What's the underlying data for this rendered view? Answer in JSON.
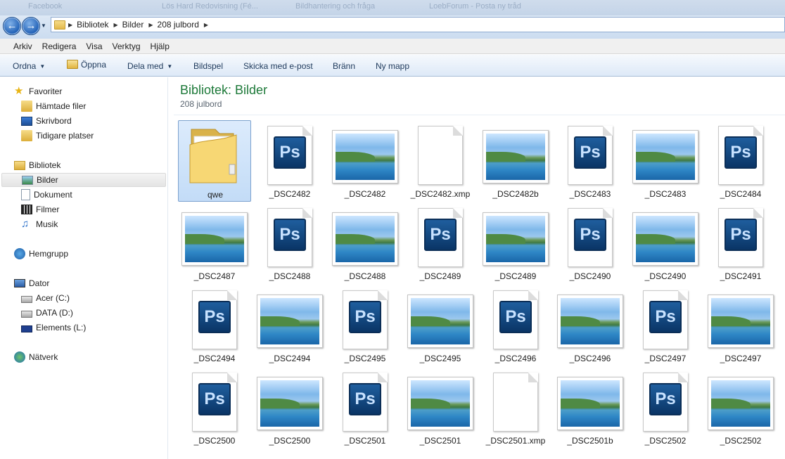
{
  "background_tabs": [
    "Facebook",
    "Lös Hard Redovisning (Fé...",
    "Bildhantering och fråga",
    "LoebForum - Posta ny tråd"
  ],
  "address": {
    "crumbs": [
      "Bibliotek",
      "Bilder",
      "208 julbord"
    ]
  },
  "menu": [
    "Arkiv",
    "Redigera",
    "Visa",
    "Verktyg",
    "Hjälp"
  ],
  "toolbar": {
    "organize": "Ordna",
    "open": "Öppna",
    "share": "Dela med",
    "slideshow": "Bildspel",
    "email": "Skicka med e-post",
    "burn": "Bränn",
    "new_folder": "Ny mapp"
  },
  "nav": {
    "favorites": "Favoriter",
    "downloads": "Hämtade filer",
    "desktop": "Skrivbord",
    "recent": "Tidigare platser",
    "libraries": "Bibliotek",
    "pictures": "Bilder",
    "documents": "Dokument",
    "videos": "Filmer",
    "music": "Musik",
    "homegroup": "Hemgrupp",
    "computer": "Dator",
    "drive_c": "Acer (C:)",
    "drive_d": "DATA (D:)",
    "drive_l": "Elements (L:)",
    "network": "Nätverk"
  },
  "content": {
    "title": "Bibliotek: Bilder",
    "subtitle": "208 julbord",
    "files": [
      {
        "name": "qwe",
        "kind": "folder"
      },
      {
        "name": "_DSC2482",
        "kind": "psd"
      },
      {
        "name": "_DSC2482",
        "kind": "photo"
      },
      {
        "name": "_DSC2482.xmp",
        "kind": "blank"
      },
      {
        "name": "_DSC2482b",
        "kind": "photo"
      },
      {
        "name": "_DSC2483",
        "kind": "psd"
      },
      {
        "name": "_DSC2483",
        "kind": "photo"
      },
      {
        "name": "_DSC2484",
        "kind": "psd"
      },
      {
        "name": "_DSC2487",
        "kind": "photo"
      },
      {
        "name": "_DSC2488",
        "kind": "psd"
      },
      {
        "name": "_DSC2488",
        "kind": "photo"
      },
      {
        "name": "_DSC2489",
        "kind": "psd"
      },
      {
        "name": "_DSC2489",
        "kind": "photo"
      },
      {
        "name": "_DSC2490",
        "kind": "psd"
      },
      {
        "name": "_DSC2490",
        "kind": "photo"
      },
      {
        "name": "_DSC2491",
        "kind": "psd"
      },
      {
        "name": "_DSC2494",
        "kind": "psd"
      },
      {
        "name": "_DSC2494",
        "kind": "photo"
      },
      {
        "name": "_DSC2495",
        "kind": "psd"
      },
      {
        "name": "_DSC2495",
        "kind": "photo"
      },
      {
        "name": "_DSC2496",
        "kind": "psd"
      },
      {
        "name": "_DSC2496",
        "kind": "photo"
      },
      {
        "name": "_DSC2497",
        "kind": "psd"
      },
      {
        "name": "_DSC2497",
        "kind": "photo"
      },
      {
        "name": "_DSC2500",
        "kind": "psd"
      },
      {
        "name": "_DSC2500",
        "kind": "photo"
      },
      {
        "name": "_DSC2501",
        "kind": "psd"
      },
      {
        "name": "_DSC2501",
        "kind": "photo"
      },
      {
        "name": "_DSC2501.xmp",
        "kind": "blank"
      },
      {
        "name": "_DSC2501b",
        "kind": "photo"
      },
      {
        "name": "_DSC2502",
        "kind": "psd"
      },
      {
        "name": "_DSC2502",
        "kind": "photo"
      }
    ],
    "ps_glyph": "Ps"
  },
  "colors": {
    "title_green": "#1e7a3a",
    "toolbar_text": "#1e395b",
    "selection": "#c3dcf7"
  }
}
